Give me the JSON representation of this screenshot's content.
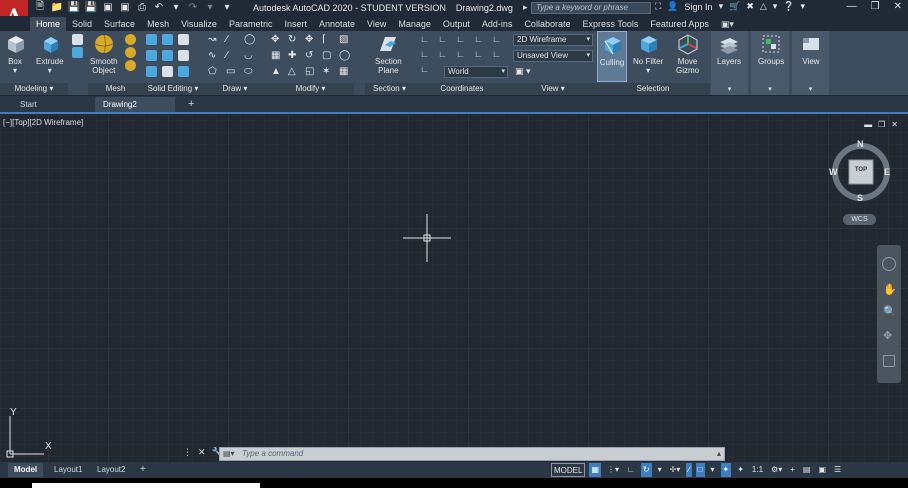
{
  "app": {
    "logo": "A",
    "title": "Autodesk AutoCAD 2020 - STUDENT VERSION    Drawing2.dwg",
    "search_placeholder": "Type a keyword or phrase",
    "sign_in": "Sign In"
  },
  "ribbon_tabs": [
    "Home",
    "Solid",
    "Surface",
    "Mesh",
    "Visualize",
    "Parametric",
    "Insert",
    "Annotate",
    "View",
    "Manage",
    "Output",
    "Add-ins",
    "Collaborate",
    "Express Tools",
    "Featured Apps"
  ],
  "ribbon": {
    "box": "Box",
    "extrude": "Extrude",
    "smooth_object": "Smooth\nObject",
    "section_plane": "Section\nPlane",
    "visual_style": "2D Wireframe",
    "view_state": "Unsaved View",
    "ucs": "World",
    "culling": "Culling",
    "no_filter": "No Filter",
    "move_gizmo": "Move\nGizmo",
    "layers": "Layers",
    "groups": "Groups",
    "view": "View",
    "panels": {
      "modeling": "Modeling",
      "mesh": "Mesh",
      "solid_editing": "Solid Editing",
      "draw": "Draw",
      "modify": "Modify",
      "section": "Section",
      "coordinates": "Coordinates",
      "view": "View",
      "selection": "Selection"
    }
  },
  "doc_tabs": [
    "Start",
    "Drawing2"
  ],
  "viewport": {
    "label": "[−][Top][2D Wireframe]",
    "viewcube_face": "TOP",
    "compass": {
      "n": "N",
      "s": "S",
      "e": "E",
      "w": "W"
    },
    "wcs": "WCS",
    "axis_x": "X",
    "axis_y": "Y"
  },
  "command": {
    "placeholder": "Type a command"
  },
  "layout_tabs": [
    "Model",
    "Layout1",
    "Layout2"
  ],
  "status": {
    "model": "MODEL",
    "scale": "1:1"
  },
  "colors": {
    "accent": "#3e7fc2",
    "logo": "#c02626",
    "canvas": "#212830"
  }
}
